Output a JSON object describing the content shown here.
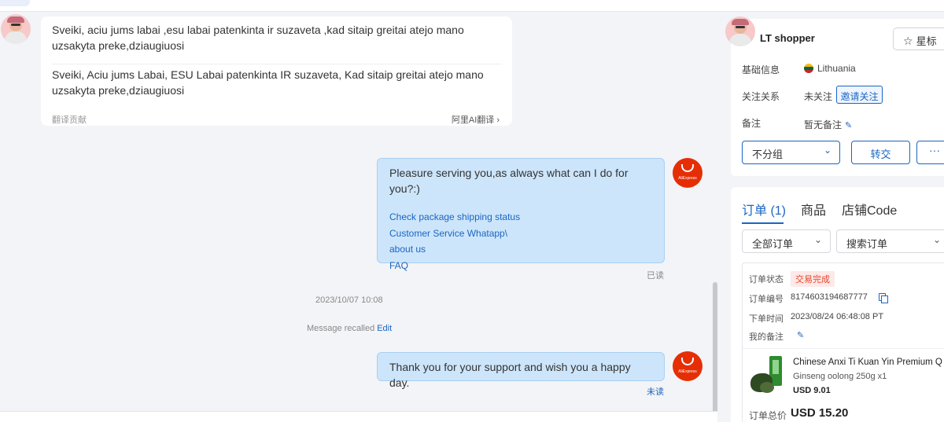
{
  "chat": {
    "incoming": {
      "original": "Sveiki, aciu jums labai ,esu labai patenkinta ir suzaveta ,kad sitaip greitai atejo mano uzsakyta preke,dziaugiuosi",
      "translated": "Sveiki, Aciu jums Labai, ESU Labai patenkinta IR suzaveta, Kad sitaip greitai atejo mano uzsakyta preke,dziaugiuosi",
      "footer_left": "翻译贡献",
      "footer_right": "阿里AI翻译 ›"
    },
    "outgoing_1": {
      "text": "Pleasure serving you,as always what can I do for you?:)",
      "links": [
        "Check package shipping status",
        "Customer Service Whatapp\\",
        "about us",
        "FAQ"
      ],
      "status": "已读"
    },
    "timestamp": "2023/10/07 10:08",
    "recalled": {
      "text": "Message recalled",
      "edit": "Edit"
    },
    "outgoing_2": {
      "text": "Thank you for your support and wish you a happy day.",
      "status": "未读"
    },
    "ae_logo_text": "AliExpress"
  },
  "customer": {
    "name": "LT shopper",
    "star_label": "星标",
    "basic_info_label": "基础信息",
    "country": "Lithuania",
    "relation_label": "关注关系",
    "relation_value": "未关注",
    "invite_label": "邀请关注",
    "note_label": "备注",
    "note_value": "暂无备注",
    "group_value": "不分组",
    "transfer_label": "转交",
    "more_label": "···"
  },
  "orders": {
    "tabs": [
      "订单 (1)",
      "商品",
      "店铺Code"
    ],
    "filter_value": "全部订单",
    "search_placeholder": "搜索订单",
    "status_label": "订单状态",
    "status_value": "交易完成",
    "number_label": "订单编号",
    "number_value": "8174603194687777",
    "time_label": "下单时间",
    "time_value": "2023/08/24 06:48:08 PT",
    "my_note_label": "我的备注",
    "product_title": "Chinese Anxi Ti Kuan Yin Premium Q",
    "product_sub": "Ginseng oolong 250g x1",
    "product_price": "USD 9.01",
    "total_label": "订单总价",
    "total_value": "USD 15.20"
  },
  "colors": {
    "accent": "#1a66c2",
    "bubble": "#cde5fb",
    "brand_red": "#e62e04",
    "status_red": "#e5462e"
  }
}
